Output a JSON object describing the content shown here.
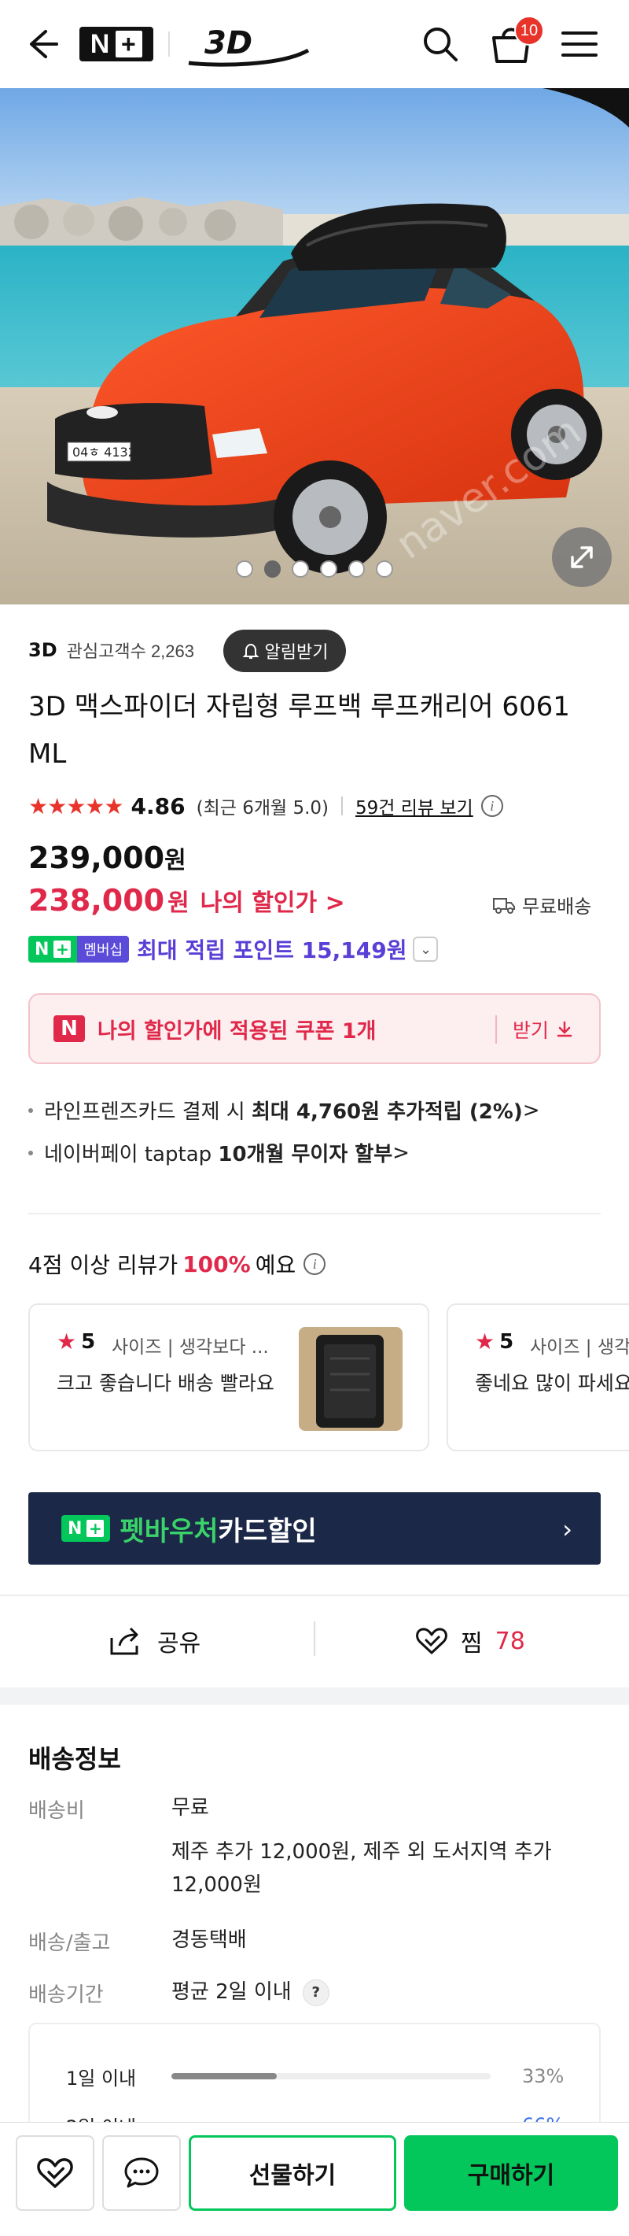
{
  "header": {
    "logo_text": "N",
    "logo_plus": "+",
    "brand_logo_text": "3D",
    "cart_count": "10"
  },
  "hero": {
    "watermark": "naver.com",
    "slide_count": 6,
    "active_slide": 2
  },
  "brand": {
    "name": "3D",
    "interest_label": "관심고객수 2,263",
    "alert_button": "알림받기"
  },
  "product": {
    "title": "3D 맥스파이더 자립형 루프백 루프캐리어 6061 ML",
    "stars": "★★★★★",
    "rating": "4.86",
    "recent_rating": "(최근 6개월 5.0)",
    "review_link": "59건 리뷰 보기",
    "original_price": "239,000",
    "price_unit": "원",
    "sale_price": "238,000",
    "sale_label": "나의 할인가 >",
    "free_shipping": "무료배송"
  },
  "membership": {
    "badge": "N",
    "badge_plus": "+",
    "label": "멤버십",
    "points_text": "최대 적립 포인트 15,149원"
  },
  "coupon": {
    "icon_text": "N",
    "text": "나의 할인가에 적용된 쿠폰 1개",
    "action": "받기"
  },
  "benefits": [
    {
      "prefix": "라인프렌즈카드 결제 시 ",
      "strong": "최대 4,760원 추가적립 (2%)",
      "suffix": " >"
    },
    {
      "prefix": "네이버페이 taptap ",
      "strong": "10개월 무이자 할부",
      "suffix": " >"
    }
  ],
  "review_stat": {
    "prefix": "4점 이상 리뷰가",
    "percent": "100%",
    "suffix": "예요"
  },
  "reviews": [
    {
      "score": "5",
      "tags": "사이즈 | 생각보다 ...",
      "body": "크고 좋습니다 배송 빨라요"
    },
    {
      "score": "5",
      "tags": "사이즈 | 생각",
      "body": "좋네요 많이 파세요"
    }
  ],
  "banner": {
    "badge": "N",
    "badge_plus": "+",
    "highlight": "펫바우처",
    "text": "카드할인"
  },
  "actions": {
    "share": "공유",
    "like": "찜",
    "like_count": "78"
  },
  "shipping": {
    "title": "배송정보",
    "fee_label": "배송비",
    "fee_value": "무료",
    "fee_extra": "제주 추가 12,000원, 제주 외 도서지역 추가 12,000원",
    "method_label": "배송/출고",
    "method_value": "경동택배",
    "period_label": "배송기간",
    "period_value": "평균 2일 이내",
    "period_help": "?"
  },
  "delivery_distribution": [
    {
      "label": "1일 이내",
      "percent": 33,
      "display": "33%"
    },
    {
      "label": "2일 이내",
      "percent": 66,
      "display": "66%"
    }
  ],
  "bottom_bar": {
    "gift_label": "선물하기",
    "buy_label": "구매하기"
  },
  "colors": {
    "naver_green": "#03c75a",
    "sale_red": "#e0294a",
    "points_purple": "#5a3fd6",
    "banner_navy": "#1b2847"
  }
}
